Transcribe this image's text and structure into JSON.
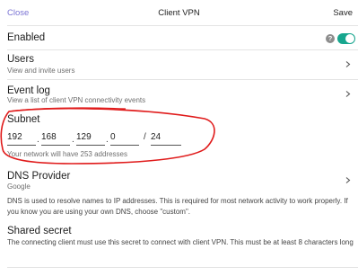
{
  "header": {
    "close_label": "Close",
    "title": "Client VPN",
    "save_label": "Save"
  },
  "enabled": {
    "label": "Enabled",
    "help_glyph": "?",
    "toggle_on": true,
    "accent_color": "#17a68e"
  },
  "users": {
    "title": "Users",
    "subtitle": "View and invite users"
  },
  "event_log": {
    "title": "Event log",
    "subtitle": "View a list of client VPN connectivity events"
  },
  "subnet": {
    "title": "Subnet",
    "octets": [
      "192",
      "168",
      "129",
      "0"
    ],
    "dot": ".",
    "slash": "/",
    "prefix": "24",
    "hint": "Your network will have 253 addresses"
  },
  "dns": {
    "title": "DNS Provider",
    "value": "Google",
    "description": "DNS is used to resolve names to IP addresses. This is required for most network activity to work properly. If you know you are using your own DNS, choose \"custom\"."
  },
  "shared_secret": {
    "title": "Shared secret",
    "description": "The connecting client must use this secret to connect with client VPN. This must be at least 8 characters long"
  },
  "annotation": {
    "color": "#e01b1b"
  },
  "icons": {
    "chevron": "chevron-right-icon",
    "help": "help-circle-icon",
    "toggle": "toggle-switch"
  }
}
